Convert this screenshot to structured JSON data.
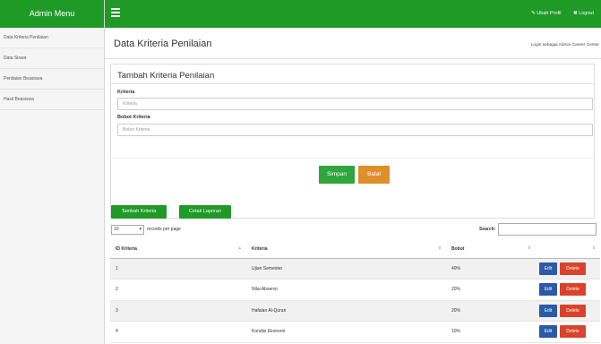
{
  "sidebar": {
    "title": "Admin Menu",
    "items": [
      {
        "label": "Data Kriteria Penilaian"
      },
      {
        "label": "Data Siswa"
      },
      {
        "label": "Penilaian Beasiswa"
      },
      {
        "label": "Hasil Beasiswa"
      }
    ]
  },
  "topbar": {
    "profile_link": "✎ Ubah Profil",
    "logout_link": "✖ Logout"
  },
  "main": {
    "page_title": "Data Kriteria Penilaian",
    "login_info": "Login sebagai Admin Career Center"
  },
  "form": {
    "title": "Tambah Kriteria Penilaian",
    "kriteria_label": "Kriteria",
    "kriteria_value": "",
    "kriteria_placeholder": "Kriteria",
    "bobot_label": "Bobot Kriteria",
    "bobot_value": "",
    "bobot_placeholder": "Bobot Kriteria",
    "save_label": "Simpan",
    "cancel_label": "Batal"
  },
  "toolbar": {
    "add_label": "Tambah Kriteria",
    "print_label": "Cetak Laporan"
  },
  "table_controls": {
    "page_length": "10",
    "records_text": "records per page",
    "search_label": "Search:",
    "search_value": ""
  },
  "table": {
    "headers": [
      "ID Kriteria",
      "Kriteria",
      "Bobot",
      ""
    ],
    "rows": [
      {
        "id": "1",
        "kriteria": "Ujian Semester",
        "bobot": "40%"
      },
      {
        "id": "2",
        "kriteria": "Nilai Absensi",
        "bobot": "20%"
      },
      {
        "id": "3",
        "kriteria": "Hafalan Al-Quran",
        "bobot": "20%"
      },
      {
        "id": "4",
        "kriteria": "Kondisi Ekonomi",
        "bobot": "10%"
      }
    ],
    "edit_label": "Edit",
    "delete_label": "Delete"
  },
  "colors": {
    "brand_green": "#1f9a27",
    "save_green": "#2fa53b",
    "cancel_orange": "#e08e2b",
    "edit_blue": "#2a5aa8",
    "delete_red": "#d9432b"
  },
  "icons": [
    "menu-icon",
    "pencil-icon",
    "close-icon",
    "sort-icon",
    "chevron-down-icon"
  ]
}
